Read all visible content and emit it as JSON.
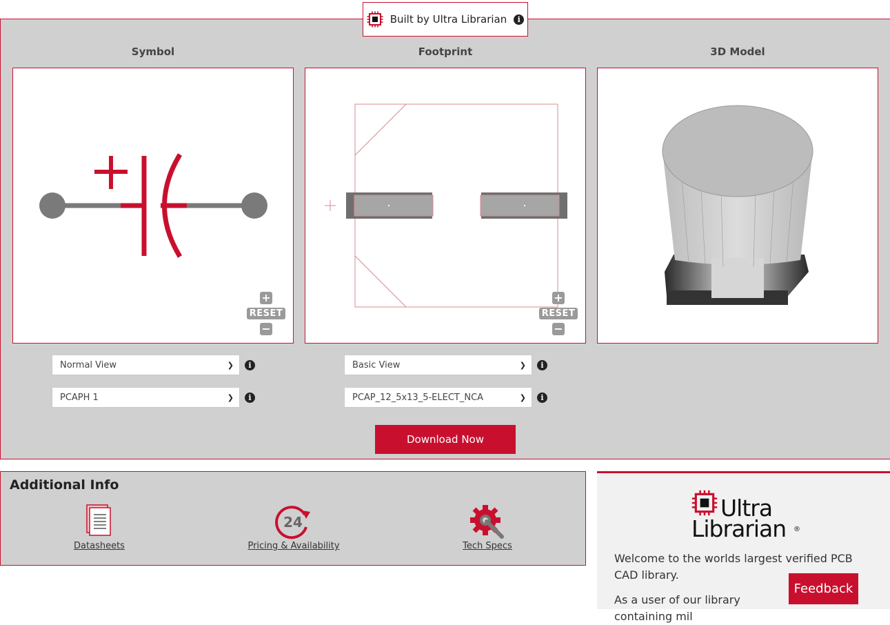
{
  "header": {
    "built_by": "Built by Ultra Librarian",
    "logo_icon": "chip-icon",
    "info_icon": "info-icon"
  },
  "columns": {
    "symbol": "Symbol",
    "footprint": "Footprint",
    "model3d": "3D Model"
  },
  "controls": {
    "zoom_in": "+",
    "reset": "RESET",
    "zoom_out": "−"
  },
  "symbol_selects": {
    "view": "Normal View",
    "part": "PCAPH 1"
  },
  "footprint_selects": {
    "view": "Basic View",
    "part": "PCAP_12_5x13_5-ELECT_NCA"
  },
  "download_label": "Download Now",
  "additional_info": {
    "title": "Additional Info",
    "links": [
      {
        "label": "Datasheets",
        "icon": "datasheet-icon"
      },
      {
        "label": "Pricing & Availability",
        "icon": "clock-24-icon"
      },
      {
        "label": "Tech Specs",
        "icon": "gear-wrench-icon"
      }
    ]
  },
  "ul_panel": {
    "logo_top": "Ultra",
    "logo_bottom": "Librarian",
    "registered": "®",
    "welcome": "Welcome to the worlds largest verified PCB CAD library.",
    "more": "As a user of our library containing mil"
  },
  "feedback_label": "Feedback",
  "colors": {
    "accent": "#c8102e",
    "panel_gray": "#d0d0d0",
    "symbol_gray": "#7a7a7a"
  }
}
